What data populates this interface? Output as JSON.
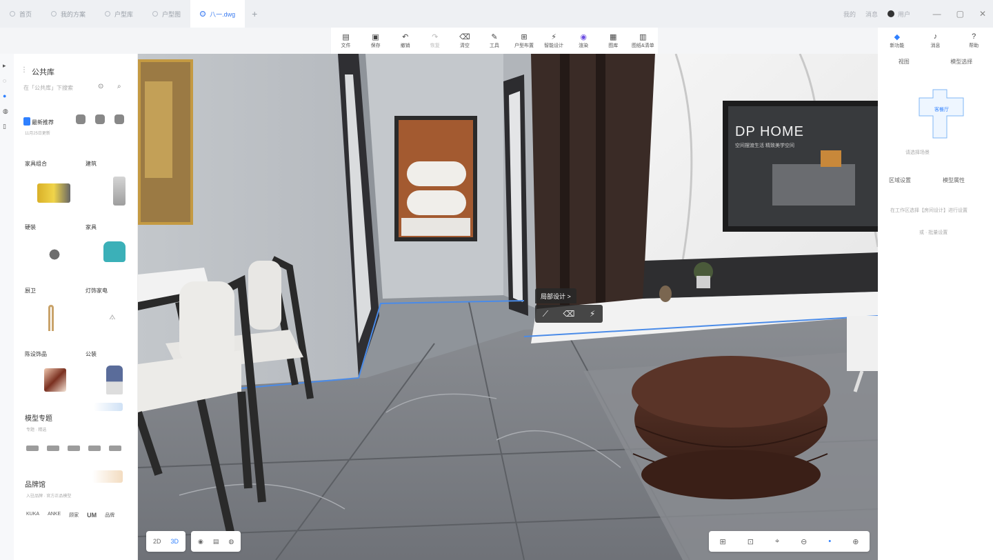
{
  "browser": {
    "tabs": [
      {
        "label": "首页",
        "active": false
      },
      {
        "label": "我的方案",
        "active": false
      },
      {
        "label": "户型库",
        "active": false
      },
      {
        "label": "户型图",
        "active": false
      },
      {
        "label": "八一.dwg",
        "active": true
      }
    ],
    "right_items": [
      "我的",
      "消息"
    ],
    "user_name": "用户",
    "window_controls": [
      "—",
      "▢",
      "✕"
    ]
  },
  "toolbar": {
    "items": [
      {
        "label": "文件",
        "icon": "file-icon"
      },
      {
        "label": "保存",
        "icon": "save-icon"
      },
      {
        "label": "撤销",
        "icon": "undo-icon"
      },
      {
        "label": "恢复",
        "icon": "redo-icon"
      },
      {
        "label": "清空",
        "icon": "eraser-icon"
      },
      {
        "label": "工具",
        "icon": "wrench-icon"
      },
      {
        "label": "户型布置",
        "icon": "layout-icon"
      },
      {
        "label": "智能设计",
        "icon": "lightning-icon"
      },
      {
        "label": "渲染",
        "icon": "camera-icon"
      },
      {
        "label": "图库",
        "icon": "gallery-icon"
      },
      {
        "label": "图纸&清单",
        "icon": "document-icon"
      }
    ]
  },
  "library": {
    "title": "公共库",
    "search_placeholder": "在「公共库」下搜索",
    "recent": {
      "label": "最新推荐",
      "sub": "11月25日更新"
    },
    "sections": [
      {
        "label": "家具组合"
      },
      {
        "label": "建筑"
      },
      {
        "label": "硬装"
      },
      {
        "label": "家具"
      },
      {
        "label": "厨卫"
      },
      {
        "label": "灯饰家电"
      },
      {
        "label": "陈设饰品"
      },
      {
        "label": "公装"
      }
    ],
    "model_topic": {
      "label": "模型专题",
      "sub": "专题 · 精选"
    },
    "brand_hall": {
      "label": "品牌馆",
      "sub": "入驻品牌 · 官方正品模型"
    },
    "brands": [
      "KUKA",
      "ANKE",
      "顾家",
      "UM",
      "品牌"
    ]
  },
  "viewport": {
    "tv_brand": "DP HOME",
    "tv_tagline": "空间摆渡生活 精致美学空间",
    "context_menu": {
      "label": "局部设计 >",
      "tools": [
        "⟋",
        "⌫",
        "⚡"
      ]
    }
  },
  "view_controls": {
    "mode_2d": "2D",
    "mode_3d": "3D",
    "right_tools": [
      "⊞",
      "⊡",
      "⌖",
      "⊖",
      "•",
      "⊕"
    ]
  },
  "right_panel": {
    "top": [
      {
        "label": "新功能",
        "icon": "diamond-icon"
      },
      {
        "label": "消息",
        "icon": "bell-icon"
      },
      {
        "label": "帮助",
        "icon": "help-icon"
      }
    ],
    "tabs": [
      "视图",
      "模型选择"
    ],
    "plan_label": "客餐厅",
    "plan_note": "请选择场景",
    "tabs2": [
      "区域设置",
      "模型属性"
    ],
    "hint1": "在工作区选择【房间设计】进行设置",
    "hint2": "或 · 批量设置"
  },
  "colors": {
    "accent": "#2f80ff",
    "panel": "#ffffff",
    "tv_bg": "#2b2b2b",
    "pouf": "#4a2a22"
  }
}
